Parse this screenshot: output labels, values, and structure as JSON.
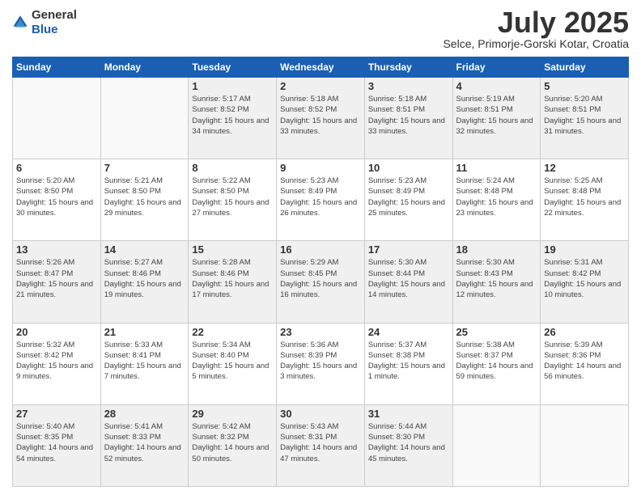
{
  "logo": {
    "general": "General",
    "blue": "Blue"
  },
  "title": {
    "month_year": "July 2025",
    "location": "Selce, Primorje-Gorski Kotar, Croatia"
  },
  "weekdays": [
    "Sunday",
    "Monday",
    "Tuesday",
    "Wednesday",
    "Thursday",
    "Friday",
    "Saturday"
  ],
  "weeks": [
    [
      {
        "day": "",
        "detail": ""
      },
      {
        "day": "",
        "detail": ""
      },
      {
        "day": "1",
        "detail": "Sunrise: 5:17 AM\nSunset: 8:52 PM\nDaylight: 15 hours and 34 minutes."
      },
      {
        "day": "2",
        "detail": "Sunrise: 5:18 AM\nSunset: 8:52 PM\nDaylight: 15 hours and 33 minutes."
      },
      {
        "day": "3",
        "detail": "Sunrise: 5:18 AM\nSunset: 8:51 PM\nDaylight: 15 hours and 33 minutes."
      },
      {
        "day": "4",
        "detail": "Sunrise: 5:19 AM\nSunset: 8:51 PM\nDaylight: 15 hours and 32 minutes."
      },
      {
        "day": "5",
        "detail": "Sunrise: 5:20 AM\nSunset: 8:51 PM\nDaylight: 15 hours and 31 minutes."
      }
    ],
    [
      {
        "day": "6",
        "detail": "Sunrise: 5:20 AM\nSunset: 8:50 PM\nDaylight: 15 hours and 30 minutes."
      },
      {
        "day": "7",
        "detail": "Sunrise: 5:21 AM\nSunset: 8:50 PM\nDaylight: 15 hours and 29 minutes."
      },
      {
        "day": "8",
        "detail": "Sunrise: 5:22 AM\nSunset: 8:50 PM\nDaylight: 15 hours and 27 minutes."
      },
      {
        "day": "9",
        "detail": "Sunrise: 5:23 AM\nSunset: 8:49 PM\nDaylight: 15 hours and 26 minutes."
      },
      {
        "day": "10",
        "detail": "Sunrise: 5:23 AM\nSunset: 8:49 PM\nDaylight: 15 hours and 25 minutes."
      },
      {
        "day": "11",
        "detail": "Sunrise: 5:24 AM\nSunset: 8:48 PM\nDaylight: 15 hours and 23 minutes."
      },
      {
        "day": "12",
        "detail": "Sunrise: 5:25 AM\nSunset: 8:48 PM\nDaylight: 15 hours and 22 minutes."
      }
    ],
    [
      {
        "day": "13",
        "detail": "Sunrise: 5:26 AM\nSunset: 8:47 PM\nDaylight: 15 hours and 21 minutes."
      },
      {
        "day": "14",
        "detail": "Sunrise: 5:27 AM\nSunset: 8:46 PM\nDaylight: 15 hours and 19 minutes."
      },
      {
        "day": "15",
        "detail": "Sunrise: 5:28 AM\nSunset: 8:46 PM\nDaylight: 15 hours and 17 minutes."
      },
      {
        "day": "16",
        "detail": "Sunrise: 5:29 AM\nSunset: 8:45 PM\nDaylight: 15 hours and 16 minutes."
      },
      {
        "day": "17",
        "detail": "Sunrise: 5:30 AM\nSunset: 8:44 PM\nDaylight: 15 hours and 14 minutes."
      },
      {
        "day": "18",
        "detail": "Sunrise: 5:30 AM\nSunset: 8:43 PM\nDaylight: 15 hours and 12 minutes."
      },
      {
        "day": "19",
        "detail": "Sunrise: 5:31 AM\nSunset: 8:42 PM\nDaylight: 15 hours and 10 minutes."
      }
    ],
    [
      {
        "day": "20",
        "detail": "Sunrise: 5:32 AM\nSunset: 8:42 PM\nDaylight: 15 hours and 9 minutes."
      },
      {
        "day": "21",
        "detail": "Sunrise: 5:33 AM\nSunset: 8:41 PM\nDaylight: 15 hours and 7 minutes."
      },
      {
        "day": "22",
        "detail": "Sunrise: 5:34 AM\nSunset: 8:40 PM\nDaylight: 15 hours and 5 minutes."
      },
      {
        "day": "23",
        "detail": "Sunrise: 5:36 AM\nSunset: 8:39 PM\nDaylight: 15 hours and 3 minutes."
      },
      {
        "day": "24",
        "detail": "Sunrise: 5:37 AM\nSunset: 8:38 PM\nDaylight: 15 hours and 1 minute."
      },
      {
        "day": "25",
        "detail": "Sunrise: 5:38 AM\nSunset: 8:37 PM\nDaylight: 14 hours and 59 minutes."
      },
      {
        "day": "26",
        "detail": "Sunrise: 5:39 AM\nSunset: 8:36 PM\nDaylight: 14 hours and 56 minutes."
      }
    ],
    [
      {
        "day": "27",
        "detail": "Sunrise: 5:40 AM\nSunset: 8:35 PM\nDaylight: 14 hours and 54 minutes."
      },
      {
        "day": "28",
        "detail": "Sunrise: 5:41 AM\nSunset: 8:33 PM\nDaylight: 14 hours and 52 minutes."
      },
      {
        "day": "29",
        "detail": "Sunrise: 5:42 AM\nSunset: 8:32 PM\nDaylight: 14 hours and 50 minutes."
      },
      {
        "day": "30",
        "detail": "Sunrise: 5:43 AM\nSunset: 8:31 PM\nDaylight: 14 hours and 47 minutes."
      },
      {
        "day": "31",
        "detail": "Sunrise: 5:44 AM\nSunset: 8:30 PM\nDaylight: 14 hours and 45 minutes."
      },
      {
        "day": "",
        "detail": ""
      },
      {
        "day": "",
        "detail": ""
      }
    ]
  ],
  "row_styles": [
    "shaded",
    "white",
    "shaded",
    "white",
    "shaded"
  ]
}
